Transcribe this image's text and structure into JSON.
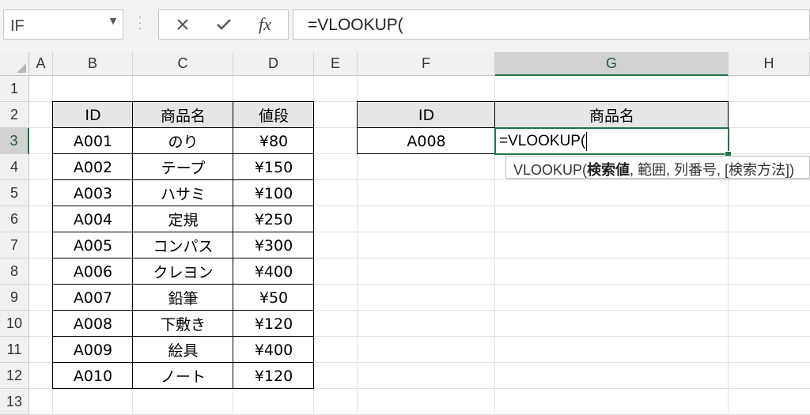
{
  "formula_bar": {
    "name_box": "IF",
    "buttons": {
      "cancel": "cancel-icon",
      "enter": "check-icon",
      "insert_function": "fx"
    },
    "formula": "=VLOOKUP("
  },
  "columns": [
    "A",
    "B",
    "C",
    "D",
    "E",
    "F",
    "G",
    "H"
  ],
  "rows": [
    "1",
    "2",
    "3",
    "4",
    "5",
    "6",
    "7",
    "8",
    "9",
    "10",
    "11",
    "12",
    "13"
  ],
  "selected": {
    "column": "G",
    "row": "3"
  },
  "product_table": {
    "headers": [
      "ID",
      "商品名",
      "値段"
    ],
    "rows": [
      [
        "A001",
        "のり",
        "¥80"
      ],
      [
        "A002",
        "テープ",
        "¥150"
      ],
      [
        "A003",
        "ハサミ",
        "¥100"
      ],
      [
        "A004",
        "定規",
        "¥250"
      ],
      [
        "A005",
        "コンパス",
        "¥300"
      ],
      [
        "A006",
        "クレヨン",
        "¥400"
      ],
      [
        "A007",
        "鉛筆",
        "¥50"
      ],
      [
        "A008",
        "下敷き",
        "¥120"
      ],
      [
        "A009",
        "絵具",
        "¥400"
      ],
      [
        "A010",
        "ノート",
        "¥120"
      ]
    ]
  },
  "lookup_table": {
    "headers": [
      "ID",
      "商品名"
    ],
    "id_value": "A008",
    "editing_value": "=VLOOKUP("
  },
  "tooltip": {
    "func": "VLOOKUP(",
    "arg_current": "検索値",
    "rest": ", 範囲, 列番号, [検索方法])"
  },
  "colors": {
    "accent": "#217346",
    "header_fill": "#e7e6e6",
    "headers_bg": "#f1f1f1",
    "grid": "#e1e1e1"
  }
}
